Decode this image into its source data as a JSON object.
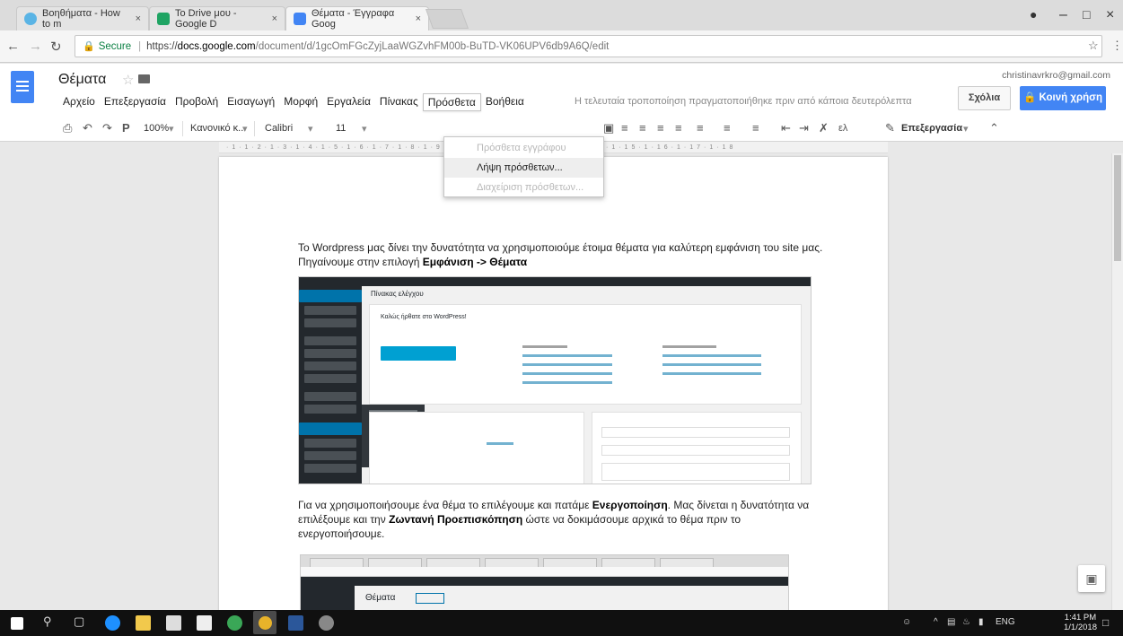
{
  "browser": {
    "tabs": [
      {
        "label": "Βοηθήματα - How to m",
        "color": "#5ab4e5"
      },
      {
        "label": "Το Drive μου - Google D",
        "color": "#1fa463"
      },
      {
        "label": "Θέματα - Έγγραφα Goog",
        "color": "#4285f4"
      }
    ],
    "url_secure": "Secure",
    "url_scheme": "https://",
    "url_host": "docs.google.com",
    "url_rest": "/document/d/1gcOmFGcZyjLaaWGZvhFM00b-BuTD-VK06UPV6db9A6Q/edit"
  },
  "docs": {
    "title": "Θέματα",
    "user_email": "christinavrkro@gmail.com",
    "menu": [
      "Αρχείο",
      "Επεξεργασία",
      "Προβολή",
      "Εισαγωγή",
      "Μορφή",
      "Εργαλεία",
      "Πίνακας",
      "Πρόσθετα",
      "Βοήθεια"
    ],
    "last_edit": "Η τελευταία τροποποίηση πραγματοποιήθηκε πριν από κάποια δευτερόλεπτα",
    "comments_label": "Σχόλια",
    "share_label": "Κοινή χρήση",
    "toolbar": {
      "zoom": "100%",
      "style": "Κανονικό κ...",
      "font": "Calibri",
      "size": "11",
      "more": "Επεξεργασία"
    }
  },
  "addons_menu": {
    "items": [
      {
        "label": "Πρόσθετα εγγράφου",
        "state": "disabled"
      },
      {
        "label": "Λήψη πρόσθετων...",
        "state": "hover"
      },
      {
        "label": "Διαχείριση πρόσθετων...",
        "state": "disabled"
      }
    ]
  },
  "document": {
    "para1_before": "Το Wordpress μας δίνει την δυνατότητα να χρησιμοποιούμε έτοιμα θέματα για καλύτερη εμφάνιση του site μας. Πηγαίνουμε στην επιλογή ",
    "para1_bold": "Εμφάνιση -> Θέματα",
    "para2_a": "Για να χρησιμοποιήσουμε ένα θέμα το επιλέγουμε και πατάμε ",
    "para2_b": "Ενεργοποίηση",
    "para2_c": ". Μας δίνεται η δυνατότητα να επιλέξουμε και την ",
    "para2_d": "Ζωντανή Προεπισκόπηση",
    "para2_e": " ώστε να δοκιμάσουμε αρχικά το θέμα πριν το ενεργοποιήσουμε.",
    "shot1_page_title": "Πίνακας ελέγχου",
    "shot1_welcome": "Καλώς ήρθατε στο WordPress!",
    "shot2_title": "Θέματα"
  },
  "taskbar": {
    "lang": "ENG",
    "time": "1:41 PM",
    "date": "1/1/2018"
  }
}
